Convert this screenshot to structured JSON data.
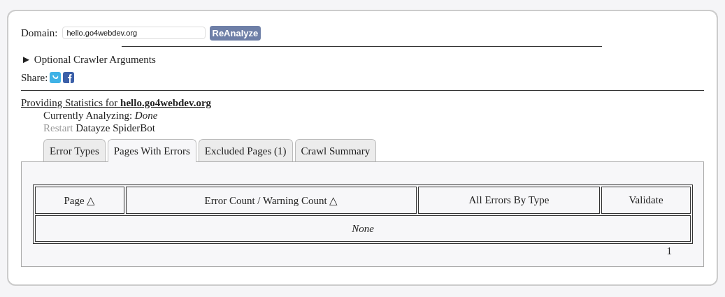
{
  "domain": {
    "label": "Domain:",
    "value": "hello.go4webdev.org",
    "button": "ReAnalyze"
  },
  "optional_args": {
    "marker": "►",
    "label": "Optional Crawler Arguments",
    "expanded": false
  },
  "share": {
    "label": "Share:"
  },
  "stats": {
    "heading": "Providing Statistics for **hello.go4webdev.org**",
    "status": "Currently Analyzing: *Done*",
    "restart": {
      "label": "Restart",
      "disabled": true
    },
    "restart_target": "Datayze SpiderBot"
  },
  "tabs": [
    {
      "label": "Error Types",
      "selected": false
    },
    {
      "label": "Pages With Errors",
      "selected": true
    },
    {
      "label": "Excluded Pages (1)",
      "selected": false
    },
    {
      "label": "Crawl Summary",
      "selected": false
    }
  ],
  "table": {
    "columns": [
      "Page △",
      "Error Count / Warning Count △",
      "All Errors By Type",
      "Validate"
    ],
    "empty_text": "None"
  },
  "pagination": "1"
}
